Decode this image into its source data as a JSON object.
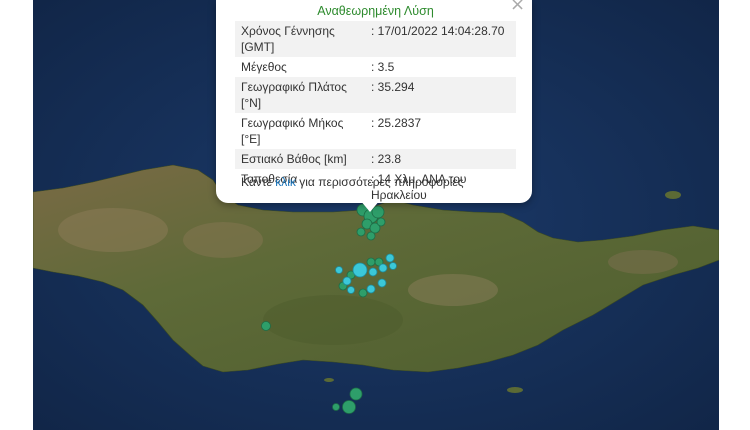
{
  "popup": {
    "title": "Αναθεωρημένη Λύση",
    "close": "×",
    "rows": [
      {
        "label": "Χρόνος Γέννησης [GMT]",
        "value": ": 17/01/2022 14:04:28.70"
      },
      {
        "label": "Μέγεθος",
        "value": ": 3.5"
      },
      {
        "label": "Γεωγραφικό Πλάτος [°N]",
        "value": ": 35.294"
      },
      {
        "label": "Γεωγραφικό Μήκος [°E]",
        "value": ": 25.2837"
      },
      {
        "label": "Εστιακό Βάθος [km]",
        "value": ": 23.8"
      },
      {
        "label": "Τοποθεσία",
        "value": ": 14 Χλμ. ΑΝΑ του Ηρακλείου"
      }
    ],
    "more_prefix": "Κάντε",
    "more_link": "κλικ",
    "more_suffix": "για περισσότερες πληροφορίες"
  },
  "colors": {
    "sea": "#16305a",
    "land": "#5b6a35",
    "older_event": "#2e9e6a",
    "recent_event": "#3bc8d8"
  }
}
